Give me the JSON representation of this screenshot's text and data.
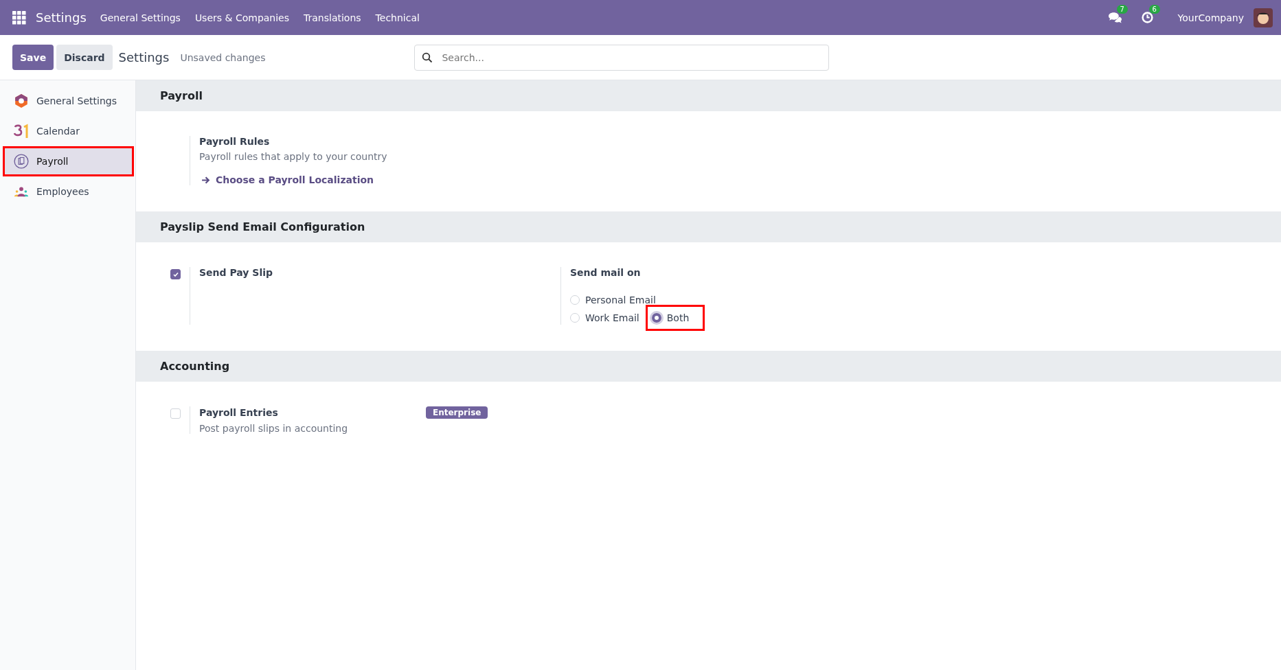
{
  "navbar": {
    "app_title": "Settings",
    "menu": [
      "General Settings",
      "Users & Companies",
      "Translations",
      "Technical"
    ],
    "messages_count": "7",
    "activities_count": "6",
    "company": "YourCompany"
  },
  "control_panel": {
    "save": "Save",
    "discard": "Discard",
    "title": "Settings",
    "status": "Unsaved changes",
    "search": {
      "placeholder": "Search..."
    }
  },
  "sidebar": {
    "items": [
      {
        "label": "General Settings",
        "kind": "general",
        "selected": false,
        "highlighted": false
      },
      {
        "label": "Calendar",
        "kind": "calendar",
        "selected": false,
        "highlighted": false
      },
      {
        "label": "Payroll",
        "kind": "payroll",
        "selected": true,
        "highlighted": true
      },
      {
        "label": "Employees",
        "kind": "employees",
        "selected": false,
        "highlighted": false
      }
    ]
  },
  "sections": [
    {
      "title": "Payroll",
      "settings": [
        {
          "kind": "link",
          "title": "Payroll Rules",
          "description": "Payroll rules that apply to your country",
          "link": "Choose a Payroll Localization"
        }
      ]
    },
    {
      "title": "Payslip Send Email Configuration",
      "settings": [
        {
          "kind": "checkbox",
          "title": "Send Pay Slip",
          "checked": true
        },
        {
          "kind": "radio",
          "title": "Send mail on",
          "options": [
            {
              "label": "Personal Email",
              "selected": false,
              "highlighted": false
            },
            {
              "label": "Work Email",
              "selected": false,
              "highlighted": false
            },
            {
              "label": "Both",
              "selected": true,
              "highlighted": true
            }
          ]
        }
      ]
    },
    {
      "title": "Accounting",
      "settings": [
        {
          "kind": "checkbox",
          "title": "Payroll Entries",
          "description": "Post payroll slips in accounting",
          "checked": false,
          "badge": "Enterprise"
        }
      ]
    }
  ]
}
